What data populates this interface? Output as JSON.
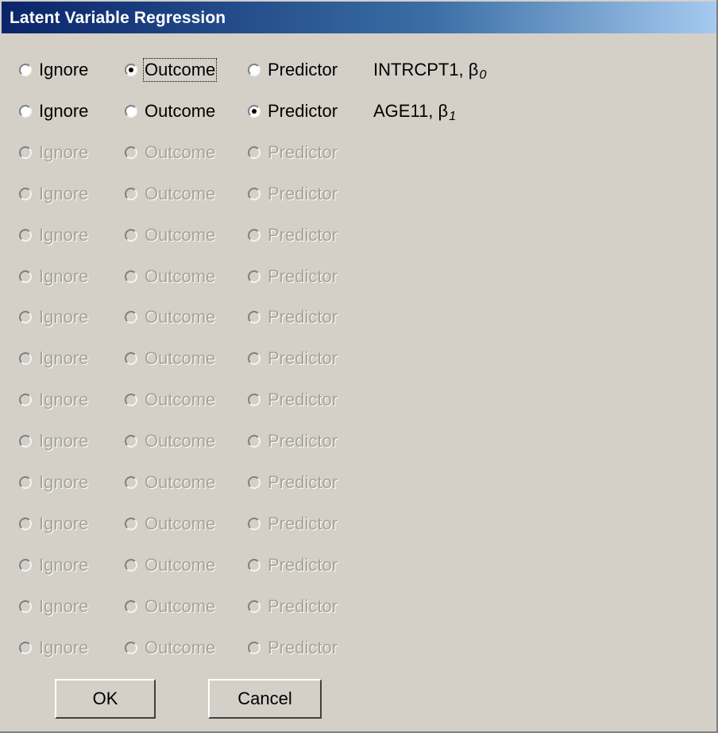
{
  "window": {
    "title": "Latent Variable Regression"
  },
  "rows": [
    {
      "enabled": true,
      "selected": "outcome",
      "variable": "INTRCPT1, β",
      "subscript": "0",
      "focus": "outcome"
    },
    {
      "enabled": true,
      "selected": "predictor",
      "variable": "AGE11, β",
      "subscript": "1",
      "focus": ""
    },
    {
      "enabled": false,
      "selected": "",
      "variable": "",
      "subscript": "",
      "focus": ""
    },
    {
      "enabled": false,
      "selected": "",
      "variable": "",
      "subscript": "",
      "focus": ""
    },
    {
      "enabled": false,
      "selected": "",
      "variable": "",
      "subscript": "",
      "focus": ""
    },
    {
      "enabled": false,
      "selected": "",
      "variable": "",
      "subscript": "",
      "focus": ""
    },
    {
      "enabled": false,
      "selected": "",
      "variable": "",
      "subscript": "",
      "focus": ""
    },
    {
      "enabled": false,
      "selected": "",
      "variable": "",
      "subscript": "",
      "focus": ""
    },
    {
      "enabled": false,
      "selected": "",
      "variable": "",
      "subscript": "",
      "focus": ""
    },
    {
      "enabled": false,
      "selected": "",
      "variable": "",
      "subscript": "",
      "focus": ""
    },
    {
      "enabled": false,
      "selected": "",
      "variable": "",
      "subscript": "",
      "focus": ""
    },
    {
      "enabled": false,
      "selected": "",
      "variable": "",
      "subscript": "",
      "focus": ""
    },
    {
      "enabled": false,
      "selected": "",
      "variable": "",
      "subscript": "",
      "focus": ""
    },
    {
      "enabled": false,
      "selected": "",
      "variable": "",
      "subscript": "",
      "focus": ""
    },
    {
      "enabled": false,
      "selected": "",
      "variable": "",
      "subscript": "",
      "focus": ""
    }
  ],
  "options": {
    "ignore": "Ignore",
    "outcome": "Outcome",
    "predictor": "Predictor"
  },
  "buttons": {
    "ok": "OK",
    "cancel": "Cancel"
  }
}
